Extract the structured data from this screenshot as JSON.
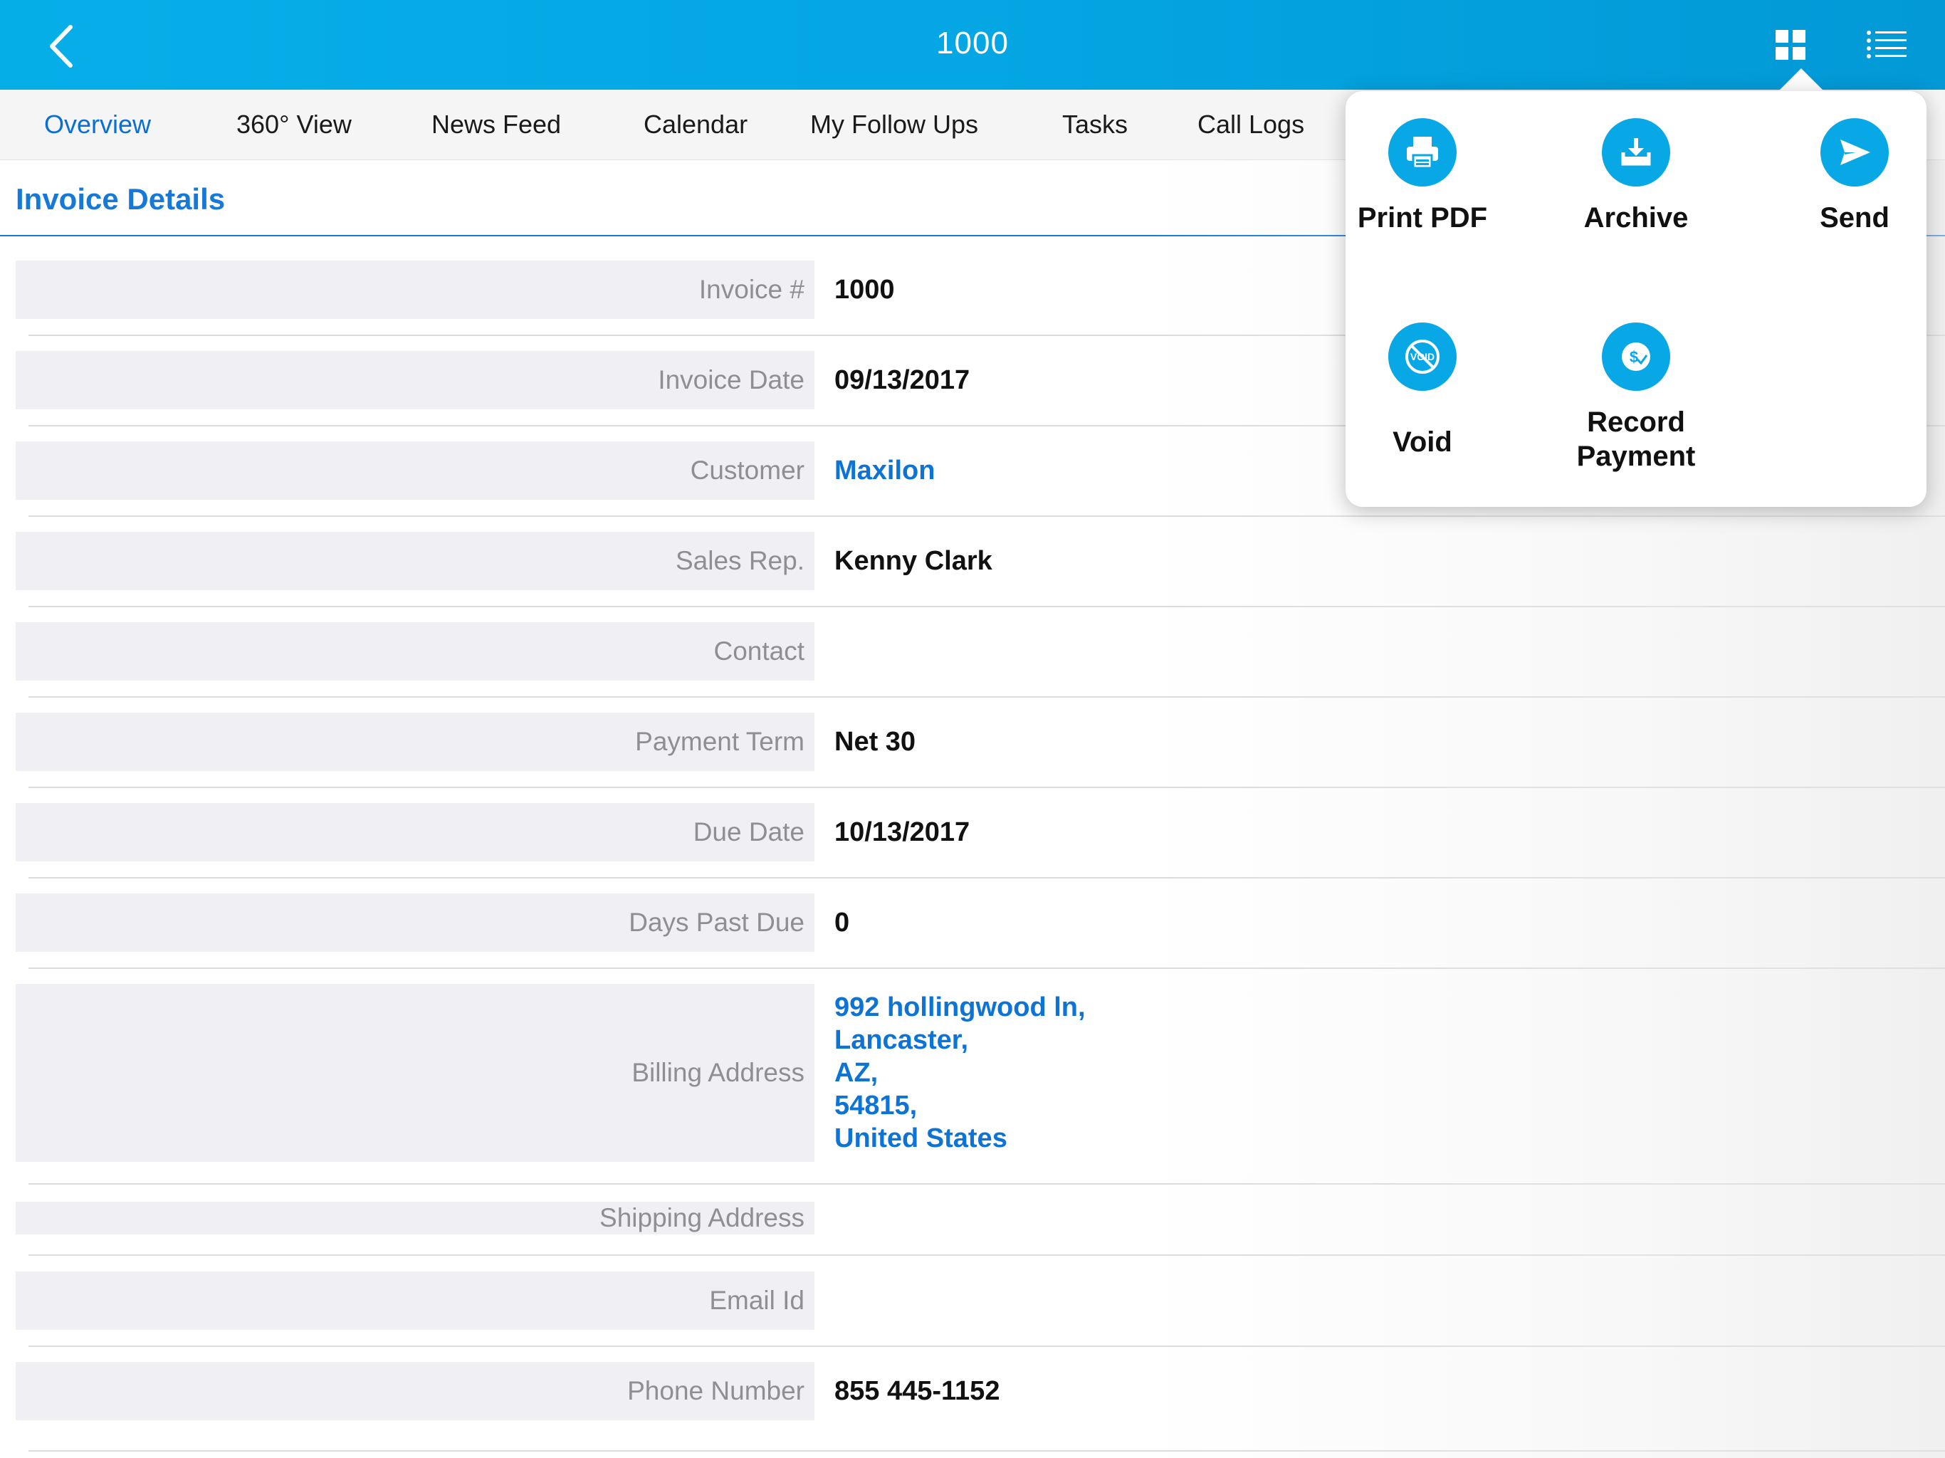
{
  "header": {
    "title": "1000",
    "back_icon": "chevron-left-icon",
    "grid_icon": "grid-icon",
    "list_icon": "list-icon",
    "color": "#04a6e3"
  },
  "tabs": [
    {
      "label": "Overview",
      "active": true
    },
    {
      "label": "360° View"
    },
    {
      "label": "News Feed"
    },
    {
      "label": "Calendar"
    },
    {
      "label": "My Follow Ups"
    },
    {
      "label": "Tasks"
    },
    {
      "label": "Call Logs"
    }
  ],
  "section": {
    "title": "Invoice Details"
  },
  "fields": {
    "invoice_no": {
      "label": "Invoice #",
      "value": "1000"
    },
    "invoice_date": {
      "label": "Invoice Date",
      "value": "09/13/2017"
    },
    "customer": {
      "label": "Customer",
      "value": "Maxilon"
    },
    "sales_rep": {
      "label": "Sales Rep.",
      "value": "Kenny Clark"
    },
    "contact": {
      "label": "Contact",
      "value": ""
    },
    "payment_term": {
      "label": "Payment Term",
      "value": "Net 30"
    },
    "due_date": {
      "label": "Due Date",
      "value": "10/13/2017"
    },
    "days_past_due": {
      "label": "Days Past Due",
      "value": "0"
    },
    "billing_address": {
      "label": "Billing Address",
      "lines": [
        "992 hollingwood ln,",
        "Lancaster,",
        "AZ,",
        "54815,",
        "United States"
      ]
    },
    "shipping_address": {
      "label": "Shipping Address",
      "value": ""
    },
    "email": {
      "label": "Email Id",
      "value": ""
    },
    "phone": {
      "label": "Phone Number",
      "value": "855 445-1152"
    }
  },
  "actions": {
    "print_pdf": {
      "label": "Print PDF",
      "icon": "printer-icon"
    },
    "archive": {
      "label": "Archive",
      "icon": "archive-download-icon"
    },
    "send": {
      "label": "Send",
      "icon": "send-icon"
    },
    "void": {
      "label": "Void",
      "icon": "void-icon"
    },
    "record_payment": {
      "label_line1": "Record",
      "label_line2": "Payment",
      "icon": "payment-icon"
    }
  },
  "colors": {
    "accent": "#08a8e6",
    "link": "#0d74d6",
    "title": "#1679d8"
  }
}
